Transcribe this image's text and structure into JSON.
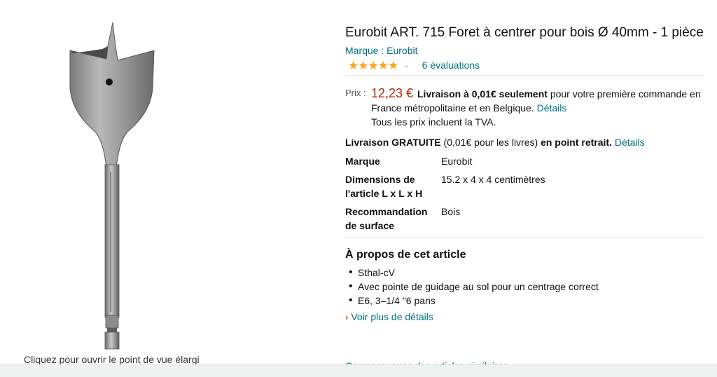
{
  "product": {
    "title": "Eurobit ART. 715 Foret à centrer pour bois Ø 40mm - 1 pièce",
    "brand_link": "Marque : Eurobit",
    "rating": {
      "value": 5,
      "count_label": "6 évaluations"
    },
    "image_caption": "Cliquez pour ouvrir le point de vue élargi"
  },
  "price": {
    "label": "Prix :",
    "value": "12,23 €",
    "delivery_bold": "Livraison à 0,01€ seulement",
    "delivery_text": " pour votre première commande en France métropolitaine et en Belgique. ",
    "details_link": "Détails",
    "tax_note": "Tous les prix incluent la TVA."
  },
  "free_delivery": {
    "bold1": "Livraison GRATUITE",
    "text": " (0,01€ pour les livres) ",
    "bold2": "en point retrait.",
    "details_link": "Détails"
  },
  "specs": [
    {
      "key": "Marque",
      "value": "Eurobit"
    },
    {
      "key": "Dimensions de l'article L x L x H",
      "value": "15.2 x 4 x 4 centimètres"
    },
    {
      "key": "Recommandation de surface",
      "value": "Bois"
    }
  ],
  "about": {
    "title": "À propos de cet article",
    "bullets": [
      "Sthal-cV",
      "Avec pointe de guidage au sol pour un centrage correct",
      "E6, 3–1/4 \"6 pans"
    ],
    "see_more": "Voir plus de détails",
    "compare": "Comparer avec des articles similaires"
  },
  "colors": {
    "link": "#007185",
    "price": "#b12704",
    "star": "#ffa41c"
  }
}
